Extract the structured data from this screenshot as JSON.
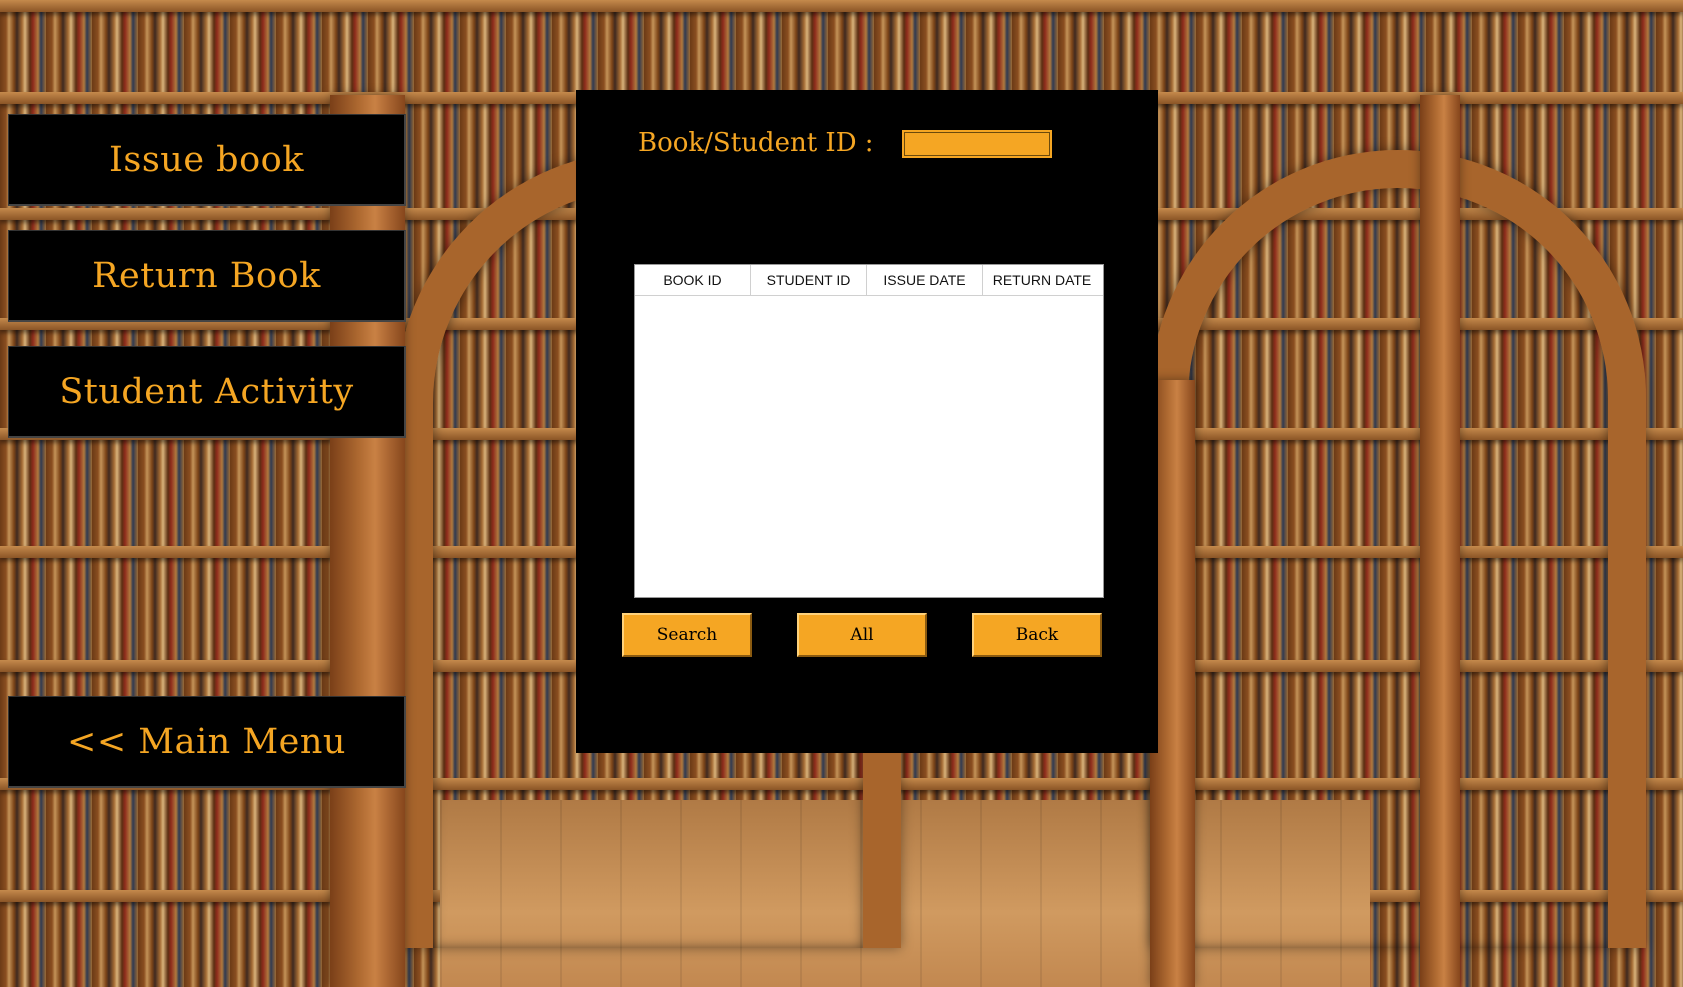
{
  "sidebar": {
    "issue_book": "Issue book",
    "return_book": "Return Book",
    "student_activity": "Student Activity",
    "main_menu": "<< Main Menu"
  },
  "search_panel": {
    "id_label": "Book/Student ID :",
    "id_value": ""
  },
  "table": {
    "columns": [
      "BOOK ID",
      "STUDENT ID",
      "ISSUE DATE",
      "RETURN DATE"
    ],
    "rows": []
  },
  "actions": {
    "search": "Search",
    "all": "All",
    "back": "Back"
  },
  "colors": {
    "accent": "#f5a623",
    "panel": "#000000",
    "grid": "#ffffff"
  }
}
